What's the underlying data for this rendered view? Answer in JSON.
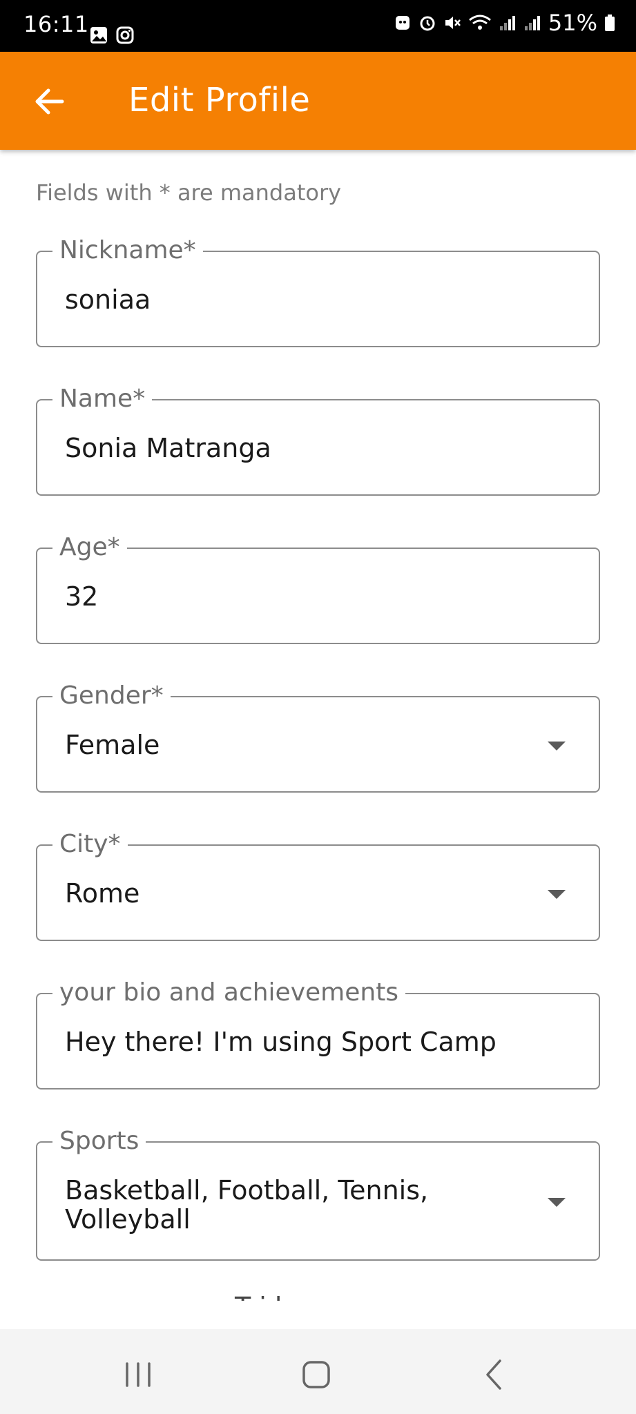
{
  "status_bar": {
    "time": "16:11",
    "battery": "51%",
    "left_icons": [
      "gallery-icon",
      "instagram-icon"
    ],
    "right_icons": [
      "android-icon",
      "alarm-icon",
      "mute-icon",
      "wifi-icon",
      "signal-icon",
      "signal-icon",
      "battery-icon"
    ]
  },
  "app_bar": {
    "title": "Edit Profile",
    "back_icon": "arrow-left-icon",
    "color": "#f58003"
  },
  "form": {
    "hint": "Fields with * are mandatory",
    "fields": [
      {
        "label": "Nickname*",
        "value": "soniaa",
        "type": "text"
      },
      {
        "label": "Name*",
        "value": "Sonia Matranga",
        "type": "text"
      },
      {
        "label": "Age*",
        "value": "32",
        "type": "text"
      },
      {
        "label": "Gender*",
        "value": "Female",
        "type": "dropdown"
      },
      {
        "label": "City*",
        "value": "Rome",
        "type": "dropdown"
      },
      {
        "label": "your bio and achievements",
        "value": "Hey there! I'm using Sport Camp",
        "type": "text"
      },
      {
        "label": "Sports",
        "value_lines": [
          "Basketball, Football, Tennis,",
          "Volleyball"
        ],
        "type": "dropdown"
      }
    ],
    "partial_text": "T        i       l       "
  },
  "nav_bar": {
    "recents_icon": "recents-icon",
    "home_icon": "home-icon",
    "back_icon": "back-icon"
  }
}
